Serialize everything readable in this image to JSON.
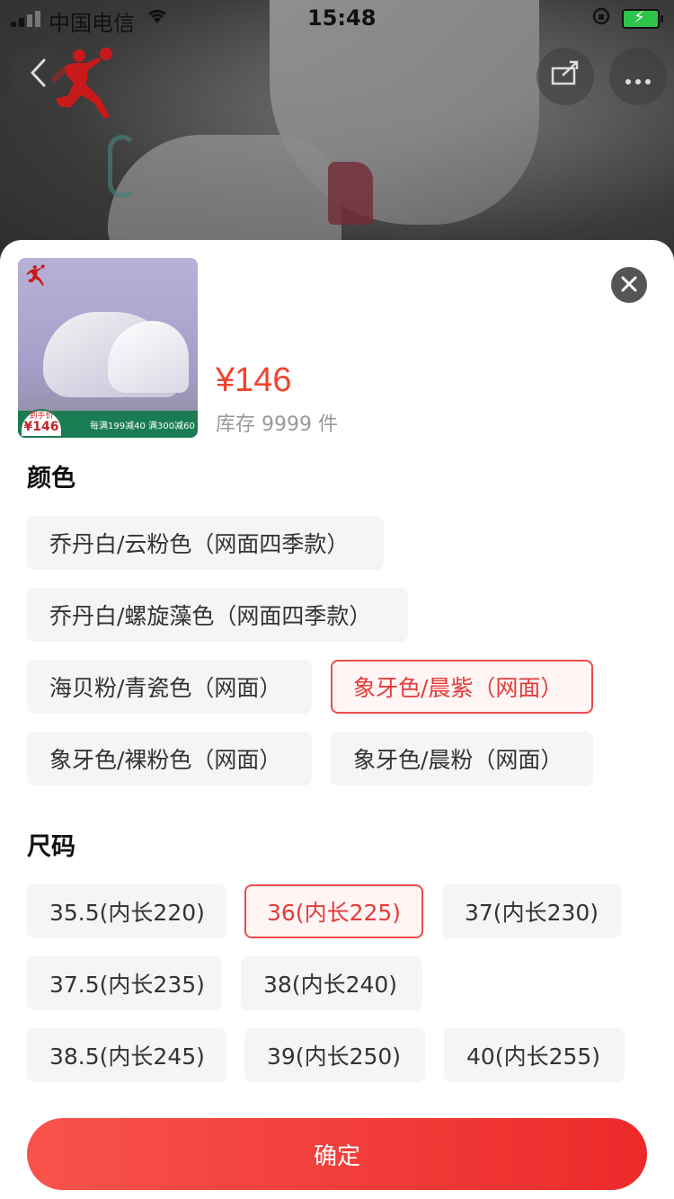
{
  "status_bar": {
    "carrier": "中国电信",
    "time": "15:48"
  },
  "product": {
    "price": "¥146",
    "stock": "库存 9999 件",
    "thumb_badge_label": "到手价",
    "thumb_badge_price": "¥146",
    "thumb_banner": "每满199减40 满300减60"
  },
  "color_section": {
    "title": "颜色",
    "options": [
      "乔丹白/云粉色（网面四季款）",
      "乔丹白/螺旋藻色（网面四季款）",
      "海贝粉/青瓷色（网面）",
      "象牙色/晨紫（网面）",
      "象牙色/裸粉色（网面）",
      "象牙色/晨粉（网面）"
    ],
    "selected": "象牙色/晨紫（网面）"
  },
  "size_section": {
    "title": "尺码",
    "options": [
      "35.5(内长220)",
      "36(内长225)",
      "37(内长230)",
      "37.5(内长235)",
      "38(内长240)",
      "38.5(内长245)",
      "39(内长250)",
      "40(内长255)"
    ],
    "selected": "36(内长225)"
  },
  "confirm_label": "确定",
  "colors": {
    "accent": "#f0442f",
    "selected_border": "#ea4c4c",
    "button_start": "#f8534b",
    "button_end": "#ec2a2a",
    "chip_bg": "#f5f5f5"
  },
  "icons": [
    "back-icon",
    "share-icon",
    "more-icon",
    "close-icon",
    "brand-logo-icon",
    "wifi-icon",
    "signal-icon",
    "battery-icon",
    "rotation-lock-icon"
  ]
}
